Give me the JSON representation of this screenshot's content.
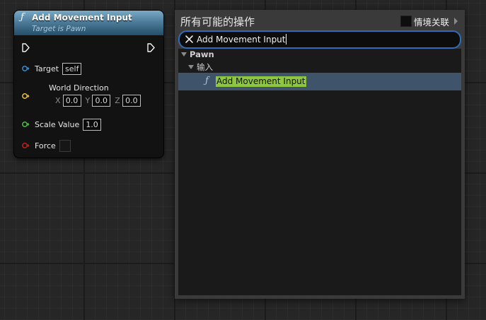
{
  "node": {
    "title": "Add Movement Input",
    "subtitle": "Target is Pawn",
    "function_icon": "ƒ",
    "pins": {
      "target": {
        "label": "Target",
        "value": "self",
        "color": "#2f8fd8"
      },
      "world_direction": {
        "label": "World Direction",
        "color": "#f0c020",
        "x_label": "X",
        "x_value": "0.0",
        "y_label": "Y",
        "y_value": "0.0",
        "z_label": "Z",
        "z_value": "0.0"
      },
      "scale_value": {
        "label": "Scale Value",
        "value": "1.0",
        "color": "#47c23a"
      },
      "force": {
        "label": "Force",
        "color": "#c81e1e"
      }
    },
    "header_color": "#4e7d9b"
  },
  "menu": {
    "title": "所有可能的操作",
    "context_sensitive_label": "情境关联",
    "search": {
      "value": "Add Movement Input"
    },
    "categories": [
      {
        "label": "Pawn"
      },
      {
        "label": "输入"
      }
    ],
    "results": [
      {
        "icon": "ƒ",
        "label": "Add Movement Input"
      }
    ],
    "highlight_color": "#8dc63f",
    "search_border_color": "#2f6db8"
  }
}
